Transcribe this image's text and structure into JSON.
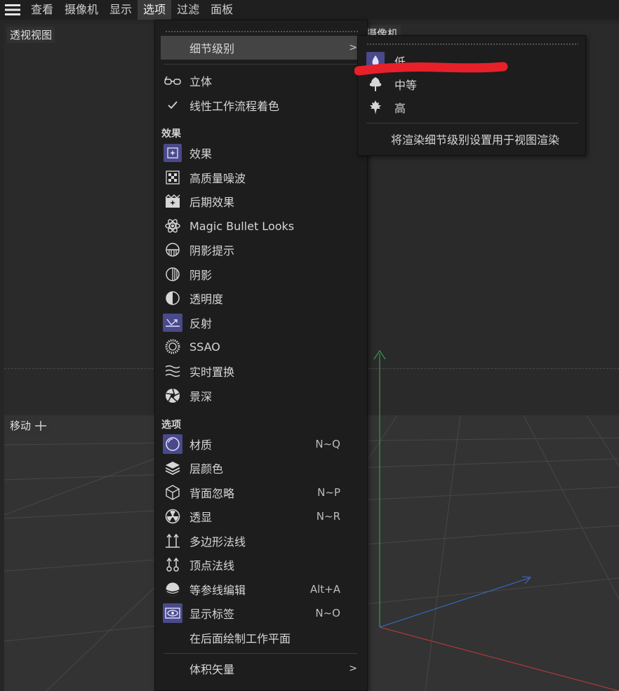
{
  "menubar": {
    "items": [
      "查看",
      "摄像机",
      "显示",
      "选项",
      "过滤",
      "面板"
    ],
    "active_index": 3
  },
  "viewport": {
    "label": "透视视图",
    "camera_label": "摄像机",
    "move_label": "移动"
  },
  "options_menu": {
    "level_of_detail": "细节级别",
    "stereo": "立体",
    "linear_workflow": "线性工作流程着色",
    "section_effects": "效果",
    "effects": [
      {
        "label": "效果",
        "icon": "effects-icon"
      },
      {
        "label": "高质量噪波",
        "icon": "noise-icon"
      },
      {
        "label": "后期效果",
        "icon": "post-effects-icon"
      },
      {
        "label": "Magic Bullet Looks",
        "icon": "atom-icon"
      },
      {
        "label": "阴影提示",
        "icon": "shadow-hint-icon"
      },
      {
        "label": "阴影",
        "icon": "shadow-icon"
      },
      {
        "label": "透明度",
        "icon": "transparency-icon"
      },
      {
        "label": "反射",
        "icon": "reflection-icon"
      },
      {
        "label": "SSAO",
        "icon": "ssao-icon"
      },
      {
        "label": "实时置换",
        "icon": "displacement-icon"
      },
      {
        "label": "景深",
        "icon": "aperture-icon"
      }
    ],
    "section_options": "选项",
    "options": [
      {
        "label": "材质",
        "shortcut": "N~Q",
        "icon": "material-icon"
      },
      {
        "label": "层颜色",
        "shortcut": "",
        "icon": "layers-icon"
      },
      {
        "label": "背面忽略",
        "shortcut": "N~P",
        "icon": "backface-icon"
      },
      {
        "label": "透显",
        "shortcut": "N~R",
        "icon": "xray-icon"
      },
      {
        "label": "多边形法线",
        "shortcut": "",
        "icon": "polygon-normals-icon"
      },
      {
        "label": "顶点法线",
        "shortcut": "",
        "icon": "vertex-normals-icon"
      },
      {
        "label": "等参线编辑",
        "shortcut": "Alt+A",
        "icon": "isoline-icon"
      },
      {
        "label": "显示标签",
        "shortcut": "N~O",
        "icon": "eye-icon"
      },
      {
        "label": "在后面绘制工作平面",
        "shortcut": "",
        "icon": ""
      }
    ],
    "volume_vector": "体积矢量"
  },
  "lod_submenu": {
    "low": "低",
    "medium": "中等",
    "high": "高",
    "apply": "将渲染细节级别设置用于视图渲染"
  },
  "colors": {
    "accent_blue": "#4a4a8a",
    "highlight_red": "#e8202a"
  }
}
